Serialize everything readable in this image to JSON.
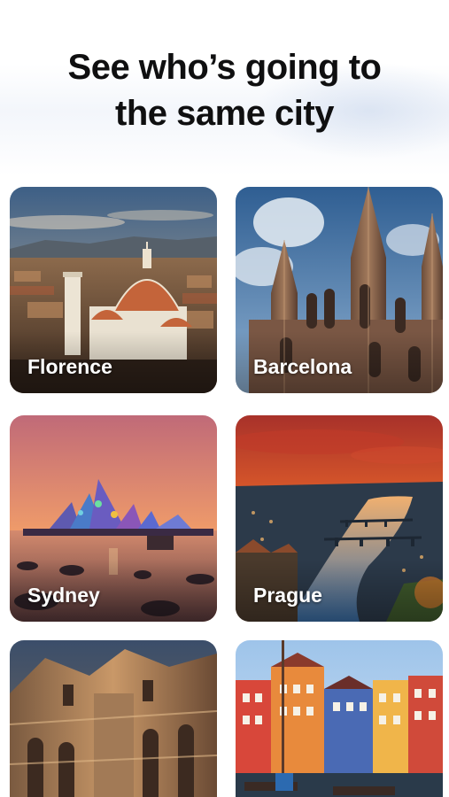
{
  "headline": {
    "line1": "See who’s going to",
    "line2": "the same city"
  },
  "cities": [
    {
      "name": "Florence"
    },
    {
      "name": "Barcelona"
    },
    {
      "name": "Sydney"
    },
    {
      "name": "Prague"
    },
    {
      "name": ""
    },
    {
      "name": ""
    }
  ]
}
